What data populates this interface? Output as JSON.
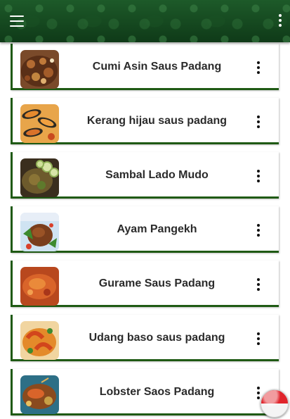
{
  "app_bar": {
    "menu_icon": "hamburger-menu-icon",
    "overflow_icon": "more-vert-icon",
    "color": "#14421e"
  },
  "recipes": [
    {
      "title": "Cumi Asin Saus Padang",
      "image": "squid-dish-thumbnail"
    },
    {
      "title": "Kerang hijau saus padang",
      "image": "mussel-dish-thumbnail"
    },
    {
      "title": "Sambal Lado Mudo",
      "image": "green-sambal-thumbnail"
    },
    {
      "title": "Ayam Pangekh",
      "image": "chicken-dish-thumbnail"
    },
    {
      "title": "Gurame Saus Padang",
      "image": "gourami-dish-thumbnail"
    },
    {
      "title": "Udang baso saus padang",
      "image": "shrimp-dish-thumbnail"
    },
    {
      "title": "Lobster Saos Padang",
      "image": "lobster-dish-thumbnail"
    }
  ],
  "card_accent": "#1f5a14",
  "language_button": {
    "icon": "indonesia-flag-icon",
    "colors": [
      "#e0242b",
      "#f4f4f4"
    ]
  }
}
